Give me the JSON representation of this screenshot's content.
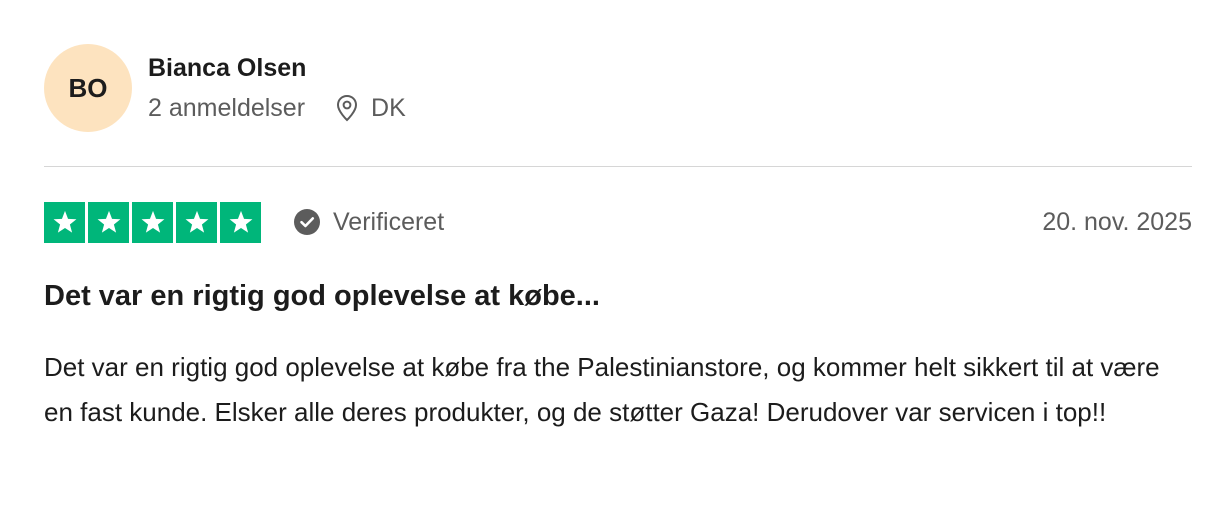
{
  "reviewer": {
    "initials": "BO",
    "name": "Bianca Olsen",
    "review_count": "2 anmeldelser",
    "country": "DK",
    "avatar_color": "#fde3bf"
  },
  "review": {
    "rating": 5,
    "max_rating": 5,
    "star_color": "#00b67a",
    "verified_label": "Verificeret",
    "date": "20. nov. 2025",
    "title": "Det var en rigtig god oplevelse at købe...",
    "body": "Det var en rigtig god oplevelse at købe fra the Palestinianstore, og kommer helt sikkert til at være en fast kunde. Elsker alle deres produkter, og de støtter Gaza! Derudover var servicen i top!!"
  },
  "icons": {
    "location": "location-pin-icon",
    "verified": "check-circle-icon",
    "star": "star-icon"
  }
}
